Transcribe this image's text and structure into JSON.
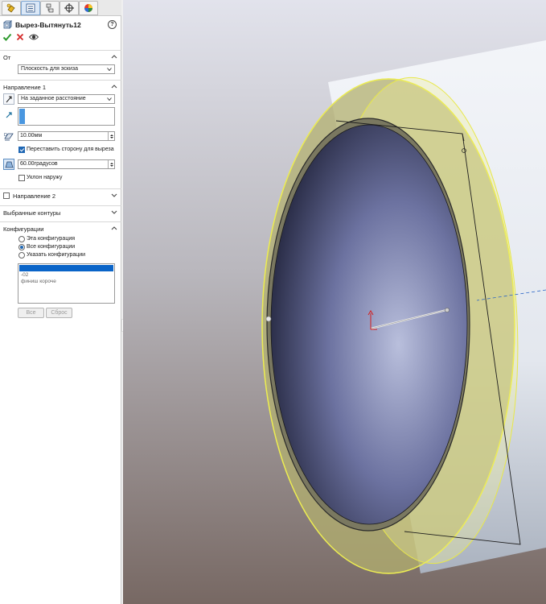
{
  "tabs": [
    {
      "icon": "feature-manager-icon"
    },
    {
      "icon": "property-manager-icon"
    },
    {
      "icon": "configuration-manager-icon"
    },
    {
      "icon": "dimxpert-icon"
    },
    {
      "icon": "display-manager-icon"
    }
  ],
  "feature": {
    "title": "Вырез-Вытянуть12",
    "help": "?"
  },
  "from": {
    "header": "От",
    "value": "Плоскость для эскиза"
  },
  "direction1": {
    "header": "Направление 1",
    "end_condition": "На заданное расстояние",
    "depth": "10.00мм",
    "flip_side_label": "Переставить сторону для выреза",
    "flip_side_checked": true,
    "draft_angle": "60.00градусов",
    "draft_outward_label": "Уклон наружу",
    "draft_outward_checked": false
  },
  "direction2": {
    "header": "Направление 2",
    "checked": false
  },
  "selected_contours": {
    "header": "Выбранные контуры"
  },
  "configurations": {
    "header": "Конфигурации",
    "options": [
      {
        "label": "Эта конфигурация",
        "selected": false
      },
      {
        "label": "Все конфигурации",
        "selected": true
      },
      {
        "label": "Указать конфигурации",
        "selected": false
      }
    ],
    "list": [
      "",
      "-02",
      "финиш короче"
    ],
    "list_selected_index": 0,
    "all_button": "Все",
    "reset_button": "Сброс"
  },
  "colors": {
    "accent": "#1f67b4",
    "face_highlight": "#e8e84a",
    "viewport_top": "#d9d9e4",
    "viewport_bottom": "#7d6f69"
  }
}
